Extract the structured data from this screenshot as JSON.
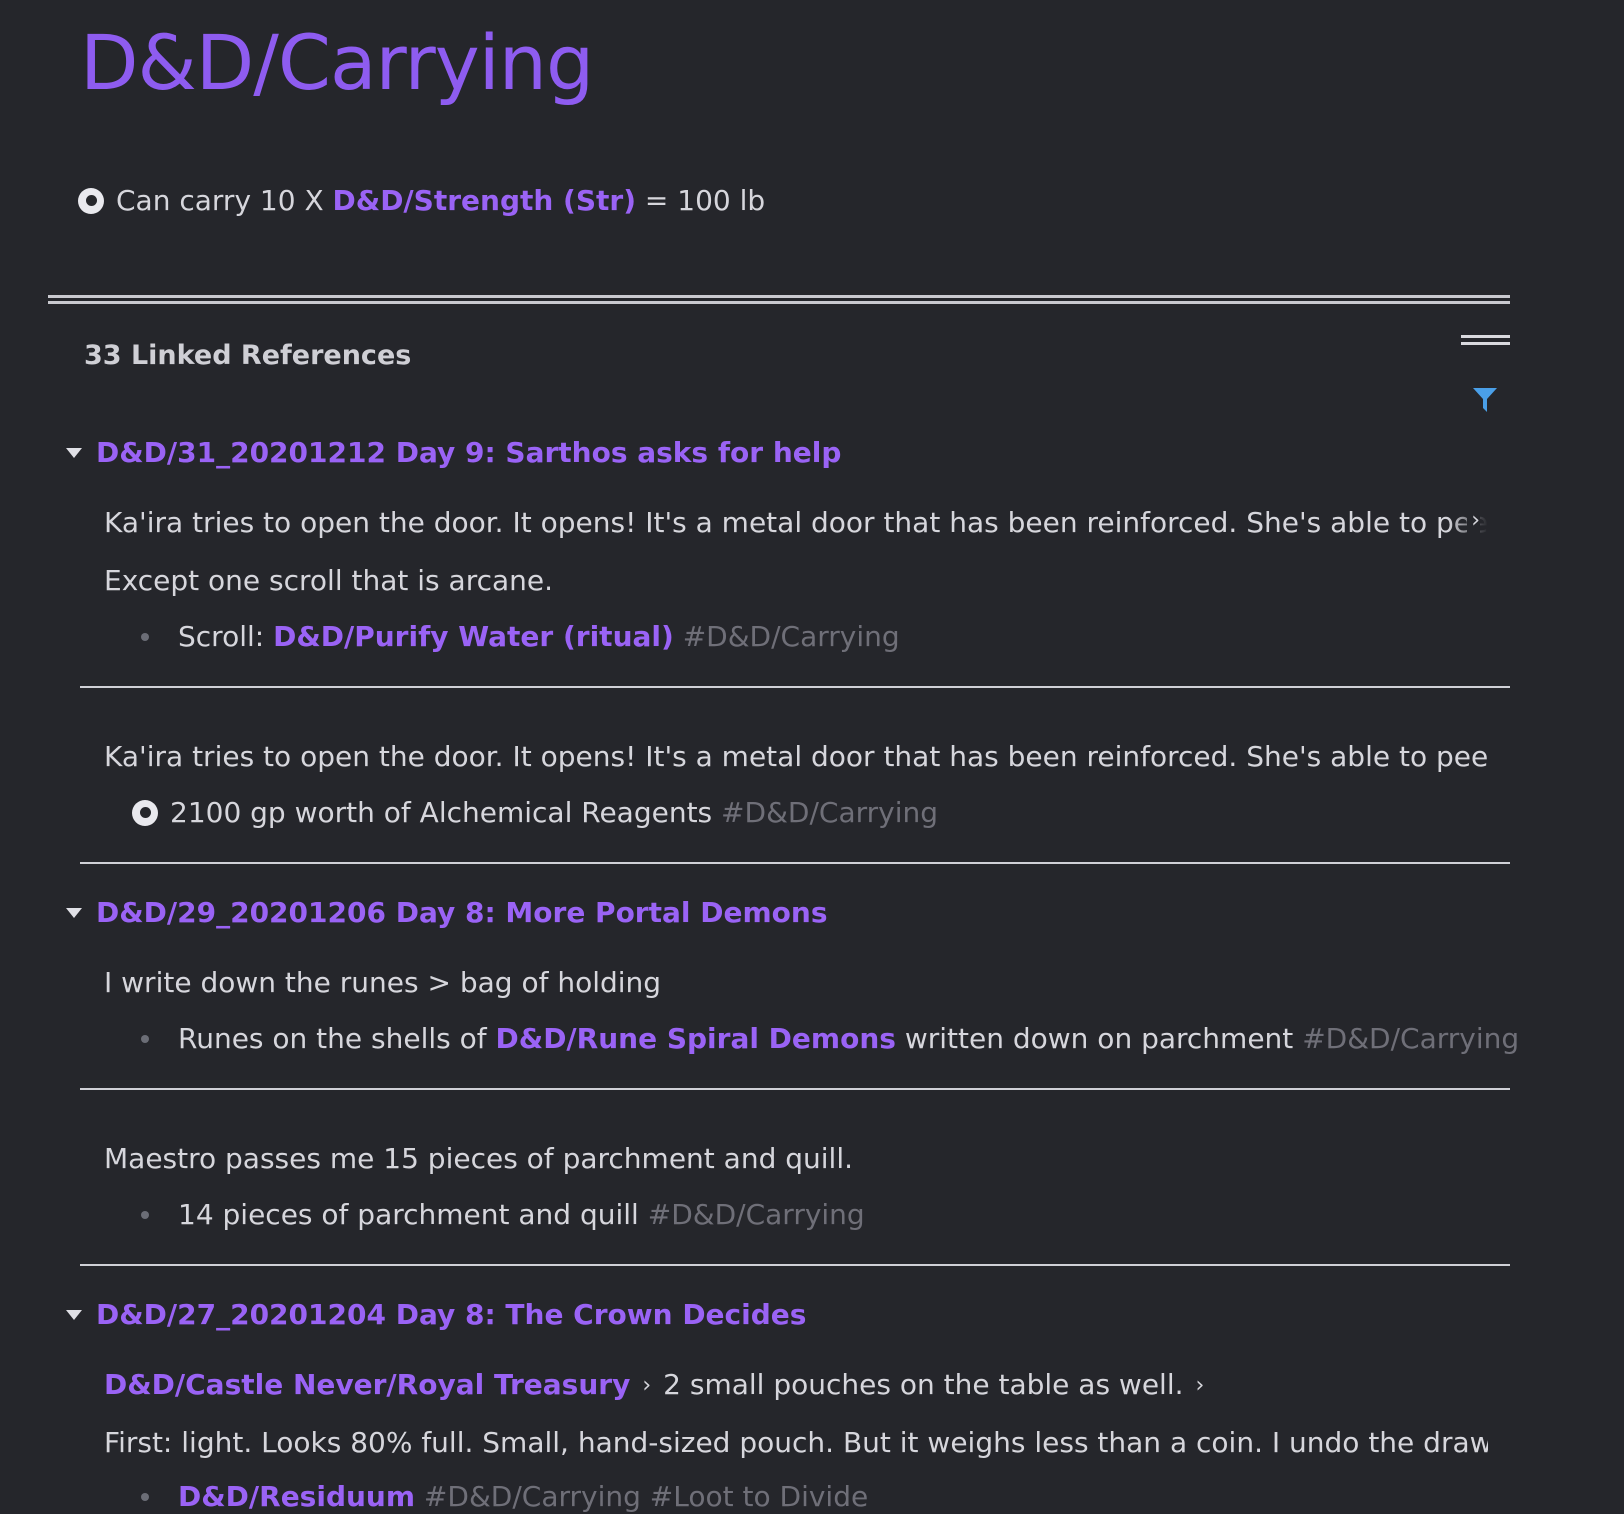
{
  "page": {
    "title": "D&D/Carrying"
  },
  "main_block": {
    "text_before": "Can carry 10 X ",
    "link": "D&D/Strength (Str)",
    "text_after": " = 100 lb"
  },
  "linked_refs": {
    "title": "33 Linked References"
  },
  "groups": [
    {
      "title": "D&D/31_20201212 Day 9: Sarthos asks for help",
      "blocks": [
        {
          "line1": "Ka'ira tries to open the door. It opens! It's a metal door that has been reinforced. She's able to peel the metal",
          "line2": "Except one scroll that is arcane.",
          "child_prefix": "Scroll: ",
          "child_link": "D&D/Purify Water (ritual)",
          "child_tag": " #D&D/Carrying"
        },
        {
          "line1": "Ka'ira tries to open the door. It opens! It's a metal door that has been reinforced. She's able to peel the metal",
          "child_text": "2100 gp worth of Alchemical Reagents",
          "child_tag": " #D&D/Carrying"
        }
      ]
    },
    {
      "title": "D&D/29_20201206 Day 8: More Portal Demons",
      "blocks": [
        {
          "line1": "I write down the runes > bag of holding",
          "child_prefix": "Runes on the shells of ",
          "child_link": "D&D/Rune Spiral Demons",
          "child_suffix": " written down on parchment",
          "child_tag": " #D&D/Carrying"
        },
        {
          "line1": "Maestro passes me 15 pieces of parchment and quill.",
          "child_text": "14 pieces of parchment and quill",
          "child_tag": " #D&D/Carrying"
        }
      ]
    },
    {
      "title": "D&D/27_20201204 Day 8: The Crown Decides",
      "blocks": [
        {
          "breadcrumb_link": "D&D/Castle Never/Royal Treasury",
          "breadcrumb_text": "2 small pouches on the table as well.",
          "line2": "First: light. Looks 80% full. Small, hand-sized pouch. But it weighs less than a coin. I undo the drawstring",
          "child_link": "D&D/Residuum",
          "child_tag": " #D&D/Carrying #Loot to Divide"
        }
      ]
    }
  ],
  "icons": {
    "chevron": "›",
    "filter_color": "#4a9fe8"
  }
}
